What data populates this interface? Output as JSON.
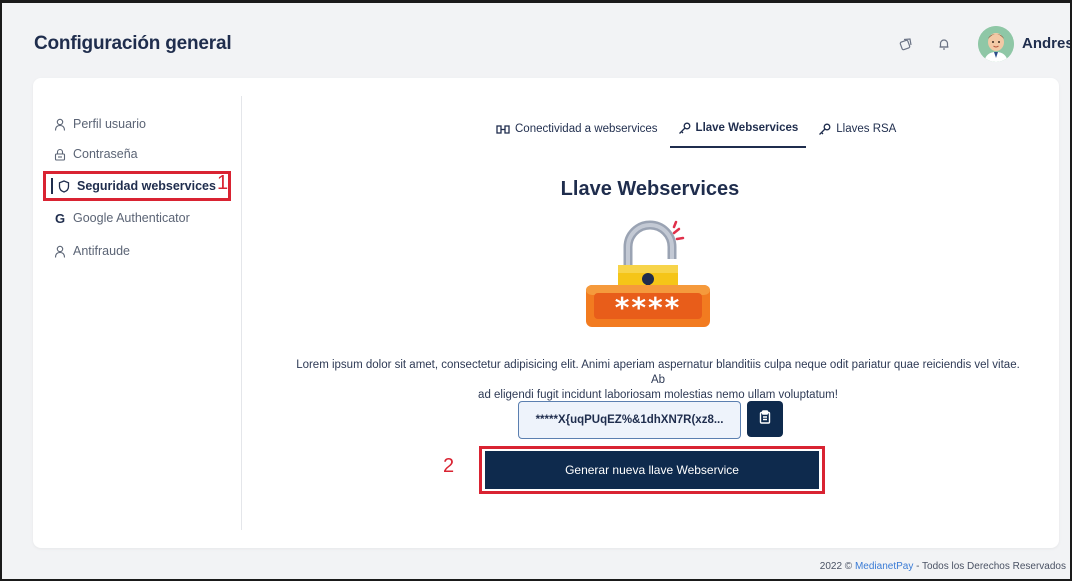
{
  "header": {
    "title": "Configuración general",
    "icons": [
      "tag-icon",
      "bell-icon"
    ],
    "user_name": "Andres"
  },
  "sidebar": {
    "items": [
      {
        "label": "Perfil usuario",
        "icon": "user-icon"
      },
      {
        "label": "Contraseña",
        "icon": "lock-icon"
      },
      {
        "label": "Seguridad webservices",
        "icon": "shield-icon",
        "active": true
      },
      {
        "label": "Google Authenticator",
        "icon": "google-icon"
      },
      {
        "label": "Antifraude",
        "icon": "user-icon"
      }
    ]
  },
  "tabs": [
    {
      "label": "Conectividad a webservices",
      "icon": "connect-icon"
    },
    {
      "label": "Llave Webservices",
      "icon": "key-icon",
      "active": true
    },
    {
      "label": "Llaves RSA",
      "icon": "key-icon"
    }
  ],
  "main": {
    "title": "Llave Webservices",
    "description_line1": "Lorem ipsum dolor sit amet, consectetur adipisicing elit. Animi aperiam aspernatur blanditiis culpa neque odit pariatur quae reiciendis vel vitae. Ab",
    "description_line2": "ad eligendi fugit incidunt laboriosam molestias nemo ullam voluptatum!",
    "key_value": "*****X{uqPUqEZ%&1dhXN7R(xz8...",
    "generate_button": "Generar nueva llave Webservice"
  },
  "annotations": {
    "callout_1": "1",
    "callout_2": "2"
  },
  "footer": {
    "prefix": "2022 © ",
    "brand": "MedianetPay",
    "suffix": " - Todos los Derechos Reservados"
  },
  "colors": {
    "primary": "#0e2a4d",
    "text_dark": "#1f2d4d",
    "highlight_red": "#d92332",
    "background": "#f2f3f5"
  }
}
